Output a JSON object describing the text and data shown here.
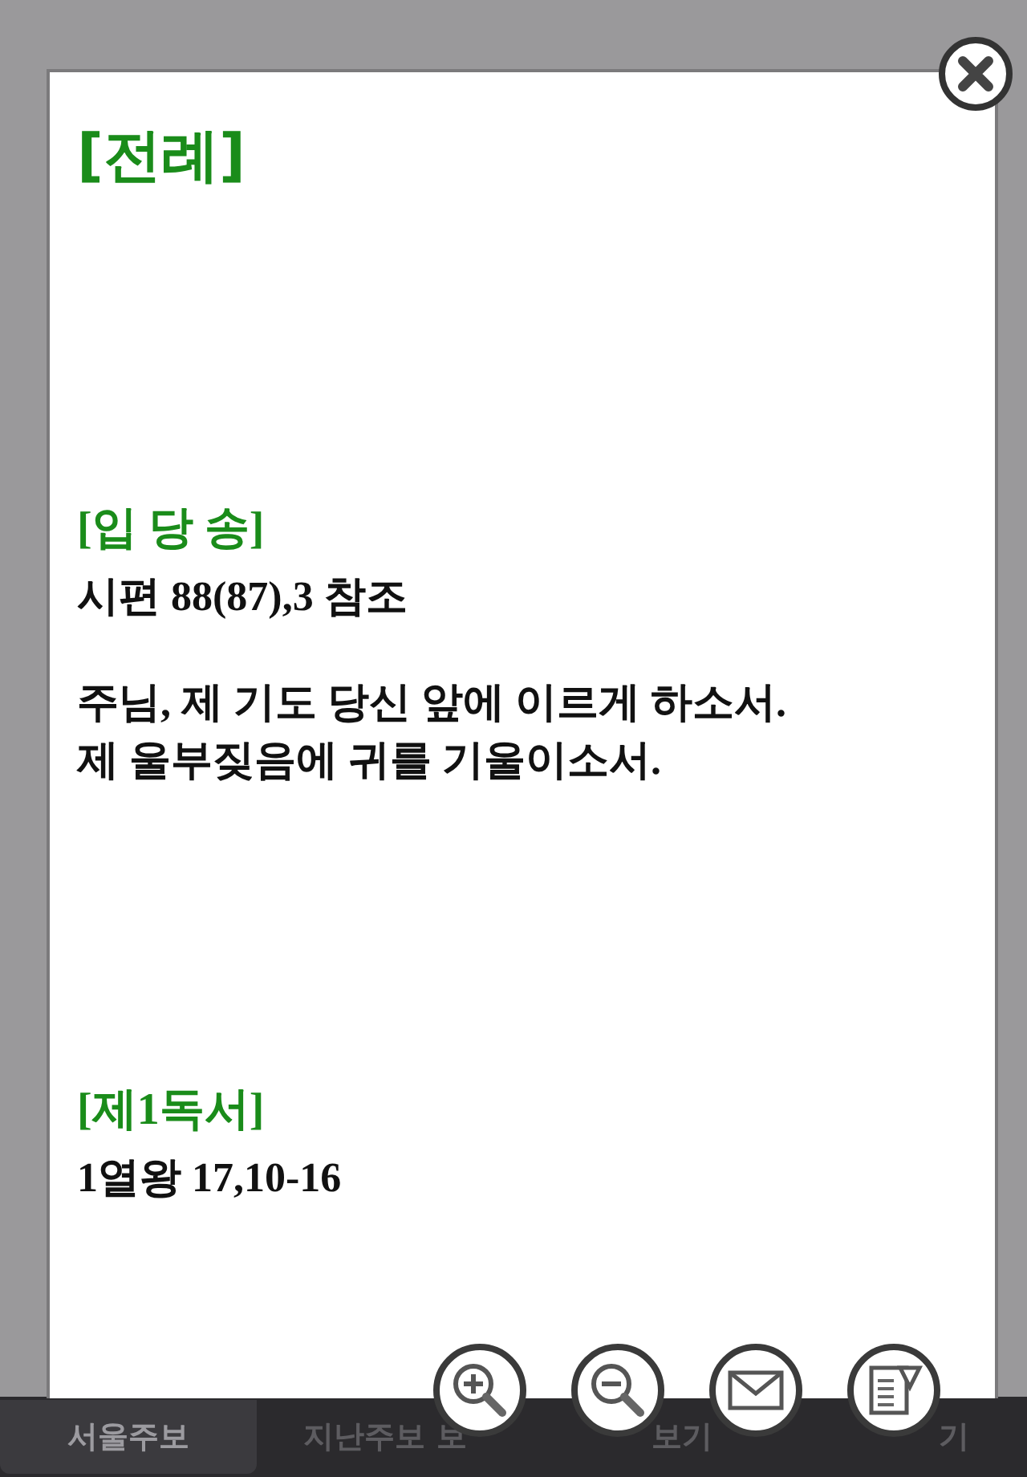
{
  "popup": {
    "title": "[전례]",
    "sections": [
      {
        "heading": "[입 당 송]",
        "paragraphs": [
          "시편 88(87),3 참조",
          "주님, 제 기도 당신 앞에 이르게 하소서.\n제 울부짖음에 귀를 기울이소서."
        ]
      },
      {
        "heading": "[제1독서]",
        "paragraphs": [
          "1열왕 17,10-16"
        ]
      }
    ],
    "actions": [
      {
        "kind": "zoom-in"
      },
      {
        "kind": "zoom-out"
      },
      {
        "kind": "mail"
      },
      {
        "kind": "memo"
      }
    ]
  },
  "tab_bar": [
    {
      "label": "서울주보",
      "selected": true
    },
    {
      "label": "지난주보 보",
      "selected": false
    },
    {
      "label": "보기",
      "selected": false
    },
    {
      "label": "기",
      "selected": false
    }
  ]
}
